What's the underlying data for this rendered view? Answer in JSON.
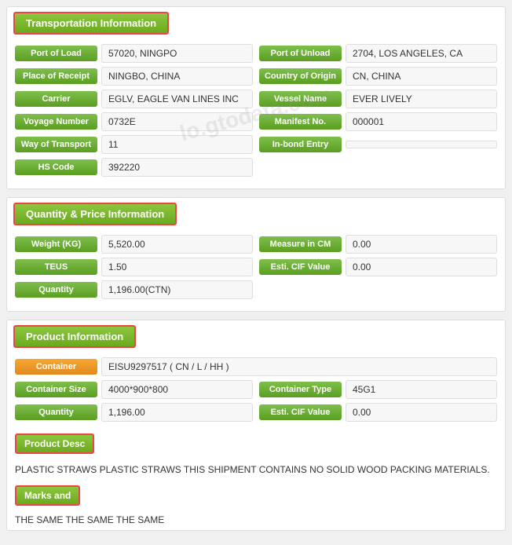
{
  "sections": {
    "transportation": {
      "title": "Transportation Information",
      "fields": {
        "port_of_load_label": "Port of Load",
        "port_of_load_value": "57020, NINGPO",
        "port_of_unload_label": "Port of Unload",
        "port_of_unload_value": "2704, LOS ANGELES, CA",
        "place_of_receipt_label": "Place of Receipt",
        "place_of_receipt_value": "NINGBO, CHINA",
        "country_of_origin_label": "Country of Origin",
        "country_of_origin_value": "CN, CHINA",
        "carrier_label": "Carrier",
        "carrier_value": "EGLV, EAGLE VAN LINES INC",
        "vessel_name_label": "Vessel Name",
        "vessel_name_value": "EVER LIVELY",
        "voyage_number_label": "Voyage Number",
        "voyage_number_value": "0732E",
        "manifest_no_label": "Manifest No.",
        "manifest_no_value": "000001",
        "way_of_transport_label": "Way of Transport",
        "way_of_transport_value": "11",
        "in_bond_entry_label": "In-bond Entry",
        "in_bond_entry_value": "",
        "hs_code_label": "HS Code",
        "hs_code_value": "392220"
      }
    },
    "quantity_price": {
      "title": "Quantity & Price Information",
      "fields": {
        "weight_label": "Weight (KG)",
        "weight_value": "5,520.00",
        "measure_label": "Measure in CM",
        "measure_value": "0.00",
        "teus_label": "TEUS",
        "teus_value": "1.50",
        "esti_cif_label": "Esti. CIF Value",
        "esti_cif_value": "0.00",
        "quantity_label": "Quantity",
        "quantity_value": "1,196.00(CTN)"
      }
    },
    "product": {
      "title": "Product Information",
      "fields": {
        "container_label": "Container",
        "container_value": "EISU9297517 ( CN / L / HH )",
        "container_size_label": "Container Size",
        "container_size_value": "4000*900*800",
        "container_type_label": "Container Type",
        "container_type_value": "45G1",
        "quantity_label": "Quantity",
        "quantity_value": "1,196.00",
        "esti_cif_label": "Esti. CIF Value",
        "esti_cif_value": "0.00",
        "product_desc_label": "Product Desc",
        "product_desc_value": "PLASTIC STRAWS PLASTIC STRAWS THIS SHIPMENT CONTAINS NO SOLID WOOD PACKING MATERIALS.",
        "marks_and_label": "Marks and",
        "marks_and_value": "THE SAME THE SAME THE SAME"
      }
    }
  },
  "watermark": "lo.gtodata.com"
}
